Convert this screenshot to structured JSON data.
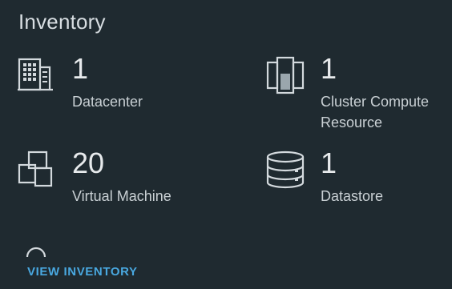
{
  "panel": {
    "title": "Inventory"
  },
  "items": [
    {
      "count": "1",
      "label": "Datacenter",
      "icon": "datacenter-icon"
    },
    {
      "count": "1",
      "label": "Cluster Compute Resource",
      "icon": "cluster-icon"
    },
    {
      "count": "20",
      "label": "Virtual Machine",
      "icon": "virtual-machine-icon"
    },
    {
      "count": "1",
      "label": "Datastore",
      "icon": "datastore-icon"
    }
  ],
  "footer": {
    "link_label": "VIEW INVENTORY"
  },
  "colors": {
    "background": "#1f2a30",
    "text": "#e7eaec",
    "muted_text": "#c9d0d4",
    "link": "#49a8e0"
  }
}
